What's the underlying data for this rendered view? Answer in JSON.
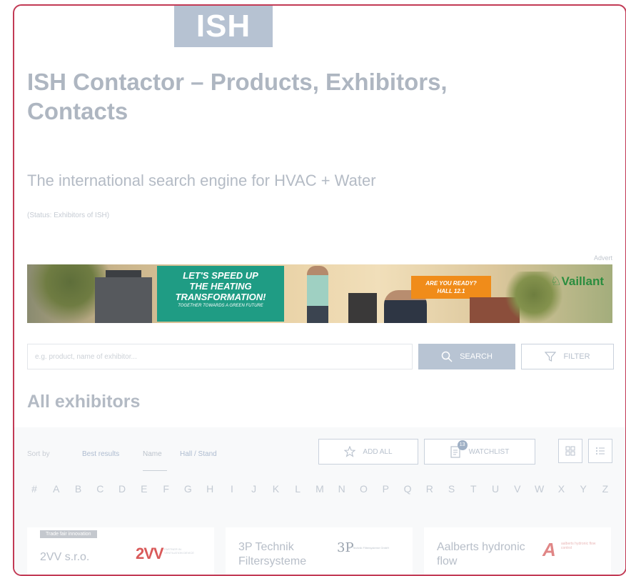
{
  "header": {
    "logo": "ISH",
    "title": "ISH Contactor – Products, Exhibitors, Contacts",
    "subtitle": "The international search engine for HVAC + Water",
    "status": "(Status: Exhibitors of ISH)"
  },
  "advert": {
    "label": "Advert",
    "headline_lines": [
      "LET'S SPEED UP",
      "THE HEATING",
      "TRANSFORMATION!"
    ],
    "tagline": "TOGETHER TOWARDS A GREEN FUTURE",
    "cta_lines": [
      "ARE YOU READY?",
      "HALL 12.1"
    ],
    "brand": "Vaillant",
    "colors": {
      "green_box": "#1f9c84",
      "orange_box": "#f08c1a",
      "brand": "#2a8d3f"
    }
  },
  "search": {
    "placeholder": "e.g. product, name of exhibitor...",
    "search_label": "SEARCH",
    "filter_label": "FILTER"
  },
  "section_title": "All exhibitors",
  "sort": {
    "label": "Sort by",
    "options": [
      "Best results",
      "Name",
      "Hall / Stand"
    ],
    "selected": "Name"
  },
  "actions": {
    "add_all": "ADD ALL",
    "watchlist": "WATCHLIST",
    "watchlist_count": "13"
  },
  "alphabet": [
    "#",
    "A",
    "B",
    "C",
    "D",
    "E",
    "F",
    "G",
    "H",
    "I",
    "J",
    "K",
    "L",
    "M",
    "N",
    "O",
    "P",
    "Q",
    "R",
    "S",
    "T",
    "U",
    "V",
    "W",
    "X",
    "Y",
    "Z"
  ],
  "exhibitors": [
    {
      "badge": "Trade fair innovation",
      "name": "2VV s.r.o.",
      "logo_text": "2VV",
      "logo_sub": "PARTNER IN VENTILATION DEVICE"
    },
    {
      "badge": "",
      "name": "3P Technik Filtersysteme",
      "logo_text": "3P",
      "logo_sub": "3P Technik Filtersysteme GmbH"
    },
    {
      "badge": "",
      "name": "Aalberts hydronic flow",
      "logo_text": "A",
      "logo_sub": "aalberts hydronic flow control"
    }
  ],
  "colors": {
    "frame_border": "#c23a55",
    "search_button": "#b8c4d3",
    "logo_bg": "#b6c2d2"
  }
}
